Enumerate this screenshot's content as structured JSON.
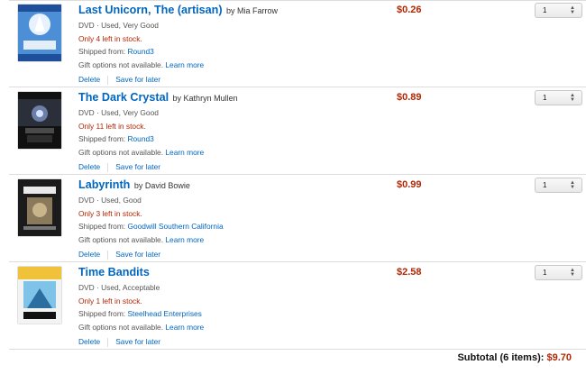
{
  "items": [
    {
      "title": "Last Unicorn, The (artisan)",
      "by": "by Mia Farrow",
      "format": "DVD · Used, Very Good",
      "stock": "Only 4 left in stock.",
      "shipped_prefix": "Shipped from: ",
      "seller": "Round3",
      "gift_text": "Gift options not available. ",
      "learn_more": "Learn more",
      "delete": "Delete",
      "save": "Save for later",
      "price": "$0.26",
      "qty": "1"
    },
    {
      "title": "The Dark Crystal",
      "by": "by Kathryn Mullen",
      "format": "DVD · Used, Very Good",
      "stock": "Only 11 left in stock.",
      "shipped_prefix": "Shipped from: ",
      "seller": "Round3",
      "gift_text": "Gift options not available. ",
      "learn_more": "Learn more",
      "delete": "Delete",
      "save": "Save for later",
      "price": "$0.89",
      "qty": "1"
    },
    {
      "title": "Labyrinth",
      "by": "by David Bowie",
      "format": "DVD · Used, Good",
      "stock": "Only 3 left in stock.",
      "shipped_prefix": "Shipped from: ",
      "seller": "Goodwill Southern California",
      "gift_text": "Gift options not available. ",
      "learn_more": "Learn more",
      "delete": "Delete",
      "save": "Save for later",
      "price": "$0.99",
      "qty": "1"
    },
    {
      "title": "Time Bandits",
      "by": "",
      "format": "DVD · Used, Acceptable",
      "stock": "Only 1 left in stock.",
      "shipped_prefix": "Shipped from: ",
      "seller": "Steelhead Enterprises",
      "gift_text": "Gift options not available. ",
      "learn_more": "Learn more",
      "delete": "Delete",
      "save": "Save for later",
      "price": "$2.58",
      "qty": "1"
    }
  ],
  "subtotal": {
    "label": "Subtotal (6 items):",
    "amount": "$9.70"
  },
  "colors": {
    "link": "#0066c0",
    "price": "#b12704",
    "divider": "#dddddd"
  }
}
